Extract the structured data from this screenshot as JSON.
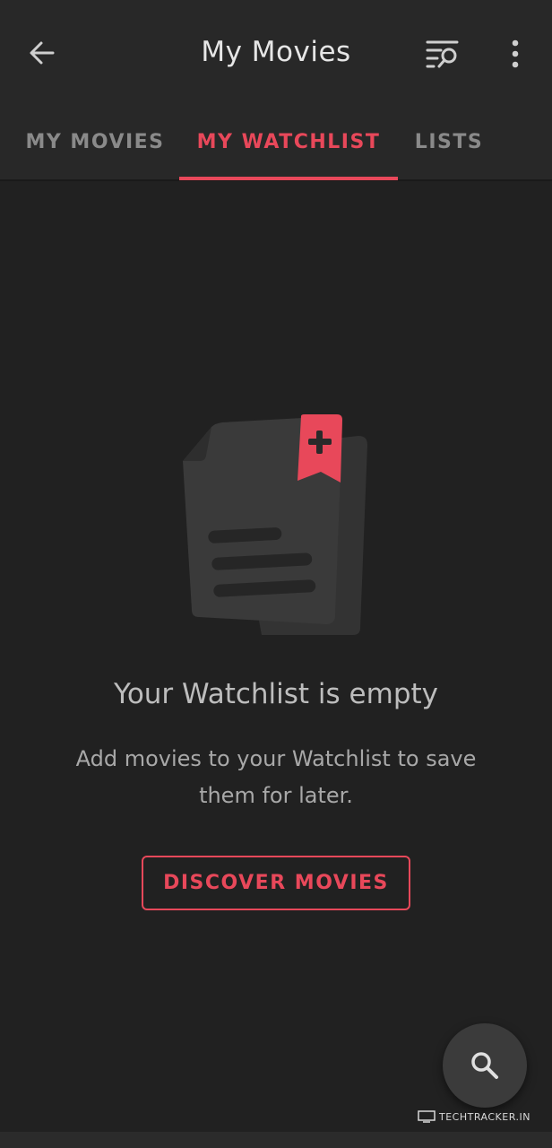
{
  "appbar": {
    "title": "My Movies",
    "back_icon": "arrow-left-icon",
    "filter_icon": "filter-search-icon",
    "more_icon": "more-vertical-icon"
  },
  "tabs": [
    {
      "label": "MY MOVIES",
      "active": false
    },
    {
      "label": "MY WATCHLIST",
      "active": true
    },
    {
      "label": "LISTS",
      "active": false
    }
  ],
  "empty_state": {
    "illustration": "watchlist-document-bookmark-icon",
    "title": "Your Watchlist is empty",
    "description": "Add movies to your Watchlist to save them for later.",
    "button_label": "DISCOVER MOVIES"
  },
  "fab": {
    "icon": "search-icon"
  },
  "watermark": {
    "text": "TECHTRACKER.IN"
  },
  "colors": {
    "accent": "#e8485a",
    "background": "#212121",
    "appbar": "#282828"
  }
}
